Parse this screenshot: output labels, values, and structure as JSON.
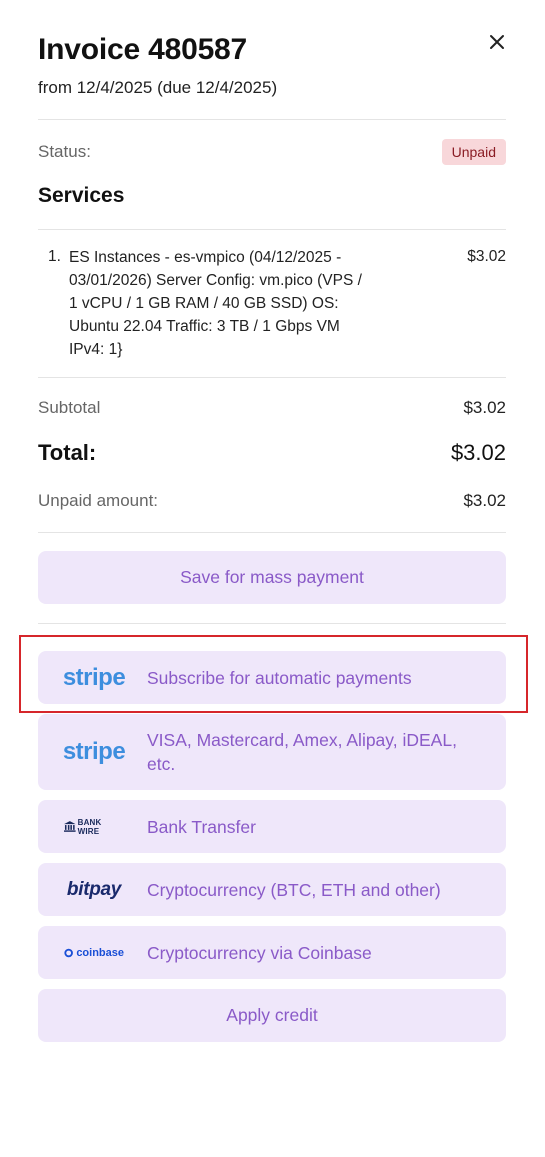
{
  "invoice": {
    "title": "Invoice 480587",
    "subtitle": "from 12/4/2025 (due 12/4/2025)"
  },
  "status": {
    "label": "Status:",
    "badge": "Unpaid",
    "badge_color": "#f8d7da"
  },
  "services": {
    "heading": "Services",
    "items": [
      {
        "number": "1.",
        "description": "ES Instances - es-vmpico (04/12/2025 - 03/01/2026) Server Config: vm.pico (VPS / 1 vCPU / 1 GB RAM / 40 GB SSD) OS: Ubuntu 22.04 Traffic: 3 TB / 1 Gbps VM IPv4: 1}",
        "price": "$3.02"
      }
    ]
  },
  "summary": {
    "subtotal_label": "Subtotal",
    "subtotal_value": "$3.02",
    "total_label": "Total:",
    "total_value": "$3.02",
    "unpaid_label": "Unpaid amount:",
    "unpaid_value": "$3.02"
  },
  "actions": {
    "mass_payment": "Save for mass payment",
    "apply_credit": "Apply credit"
  },
  "payment_methods": [
    {
      "logo": "stripe",
      "logo_text": "stripe",
      "label": "Subscribe for automatic payments"
    },
    {
      "logo": "stripe",
      "logo_text": "stripe",
      "label": "VISA, Mastercard, Amex, Alipay, iDEAL, etc."
    },
    {
      "logo": "bank-wire",
      "logo_text": "BANK WIRE",
      "label": "Bank Transfer"
    },
    {
      "logo": "bitpay",
      "logo_text": "bitpay",
      "label": "Cryptocurrency (BTC, ETH and other)"
    },
    {
      "logo": "coinbase",
      "logo_text": "coinbase",
      "label": "Cryptocurrency via Coinbase"
    }
  ],
  "icons": {
    "close": "close-icon"
  },
  "colors": {
    "button_bg": "#efe7fa",
    "button_text": "#8a5ac8",
    "highlight": "#d6262b",
    "stripe": "#3d8ede"
  }
}
